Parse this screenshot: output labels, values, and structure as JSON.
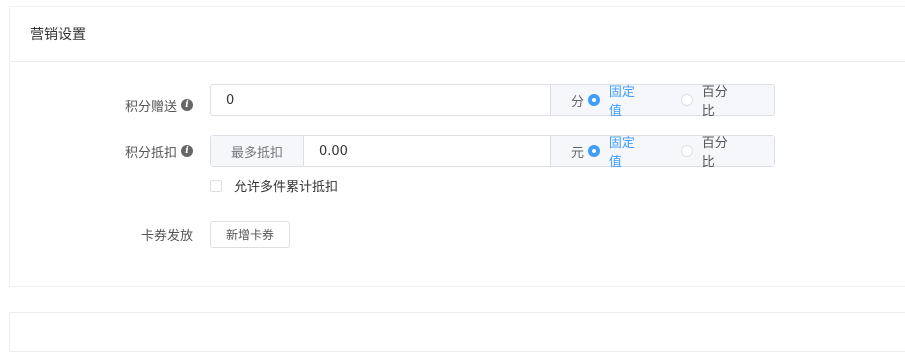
{
  "section": {
    "title": "营销设置"
  },
  "points_gift": {
    "label": "积分赠送",
    "value": "0",
    "unit": "分",
    "options": [
      {
        "label": "固定值",
        "checked": true
      },
      {
        "label": "百分比",
        "checked": false
      }
    ]
  },
  "points_deduct": {
    "label": "积分抵扣",
    "prefix": "最多抵扣",
    "value": "0.00",
    "unit": "元",
    "options": [
      {
        "label": "固定值",
        "checked": true
      },
      {
        "label": "百分比",
        "checked": false
      }
    ],
    "allow_multiple_label": "允许多件累计抵扣",
    "allow_multiple_checked": false
  },
  "coupon": {
    "label": "卡券发放",
    "button_label": "新增卡券"
  },
  "colors": {
    "accent": "#409eff",
    "border": "#dcdfe6",
    "addon_bg": "#f5f7fa"
  }
}
